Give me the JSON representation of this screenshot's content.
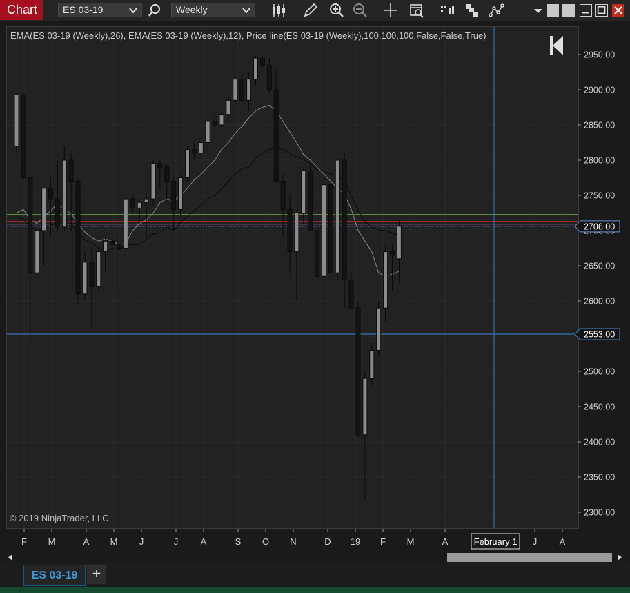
{
  "toolbar": {
    "title": "Chart",
    "instrument": "ES 03-19",
    "interval": "Weekly",
    "icons": [
      "search-icon",
      "candlestick-icon",
      "pencil-icon",
      "zoom-in-icon",
      "zoom-out-icon",
      "crosshair-icon",
      "data-box-icon",
      "bar-spacing-icon",
      "properties-icon",
      "strategy-icon"
    ]
  },
  "indicator_label": "EMA(ES 03-19 (Weekly),26), EMA(ES 03-19 (Weekly),12), Price line(ES 03-19 (Weekly),100,100,100,False,False,True)",
  "copyright": "© 2019 NinjaTrader, LLC",
  "tabs": [
    {
      "label": "ES 03-19",
      "active": true
    }
  ],
  "add_tab_label": "+",
  "chart_data": {
    "type": "candlestick",
    "instrument": "ES 03-19",
    "interval": "Weekly",
    "y_ticks": [
      "2950.00",
      "2900.00",
      "2850.00",
      "2800.00",
      "2750.00",
      "2700.00",
      "2650.00",
      "2600.00",
      "2550.00",
      "2500.00",
      "2450.00",
      "2400.00",
      "2350.00",
      "2300.00"
    ],
    "ylim": [
      2280,
      2975
    ],
    "x_ticks": [
      "F",
      "M",
      "A",
      "M",
      "J",
      "J",
      "A",
      "S",
      "O",
      "N",
      "D",
      "19",
      "F",
      "M",
      "A",
      "February 1",
      "J",
      "A"
    ],
    "price_markers": [
      {
        "label": "2706.00",
        "value": 2706,
        "color": "#6a8fd6"
      },
      {
        "label": "2553.00",
        "value": 2553,
        "color": "#3a8ad6"
      }
    ],
    "reference_lines": [
      {
        "value": 2723,
        "color": "#5a8a3a"
      },
      {
        "value": 2713,
        "color": "#c03030"
      },
      {
        "value": 2709,
        "color": "#8a4a8a"
      },
      {
        "value": 2706,
        "color": "#6a8fd6"
      },
      {
        "value": 2553,
        "color": "#3a8ad6"
      }
    ],
    "crosshair_label": "February 1",
    "candles": [
      {
        "o": 2820,
        "h": 2895,
        "l": 2810,
        "c": 2893
      },
      {
        "o": 2893,
        "h": 2897,
        "l": 2770,
        "c": 2775
      },
      {
        "o": 2775,
        "h": 2775,
        "l": 2545,
        "c": 2640
      },
      {
        "o": 2640,
        "h": 2720,
        "l": 2630,
        "c": 2700
      },
      {
        "o": 2700,
        "h": 2730,
        "l": 2650,
        "c": 2760
      },
      {
        "o": 2760,
        "h": 2775,
        "l": 2690,
        "c": 2745
      },
      {
        "o": 2745,
        "h": 2800,
        "l": 2700,
        "c": 2705
      },
      {
        "o": 2705,
        "h": 2820,
        "l": 2700,
        "c": 2800
      },
      {
        "o": 2800,
        "h": 2810,
        "l": 2700,
        "c": 2770
      },
      {
        "o": 2770,
        "h": 2775,
        "l": 2595,
        "c": 2610
      },
      {
        "o": 2610,
        "h": 2670,
        "l": 2600,
        "c": 2655
      },
      {
        "o": 2655,
        "h": 2675,
        "l": 2560,
        "c": 2620
      },
      {
        "o": 2620,
        "h": 2675,
        "l": 2615,
        "c": 2670
      },
      {
        "o": 2670,
        "h": 2690,
        "l": 2640,
        "c": 2685
      },
      {
        "o": 2685,
        "h": 2700,
        "l": 2620,
        "c": 2680
      },
      {
        "o": 2680,
        "h": 2690,
        "l": 2600,
        "c": 2675
      },
      {
        "o": 2675,
        "h": 2745,
        "l": 2665,
        "c": 2745
      },
      {
        "o": 2745,
        "h": 2750,
        "l": 2725,
        "c": 2732
      },
      {
        "o": 2732,
        "h": 2745,
        "l": 2710,
        "c": 2740
      },
      {
        "o": 2740,
        "h": 2750,
        "l": 2690,
        "c": 2745
      },
      {
        "o": 2745,
        "h": 2800,
        "l": 2735,
        "c": 2795
      },
      {
        "o": 2795,
        "h": 2800,
        "l": 2760,
        "c": 2790
      },
      {
        "o": 2790,
        "h": 2795,
        "l": 2740,
        "c": 2770
      },
      {
        "o": 2770,
        "h": 2775,
        "l": 2700,
        "c": 2730
      },
      {
        "o": 2730,
        "h": 2780,
        "l": 2720,
        "c": 2775
      },
      {
        "o": 2775,
        "h": 2820,
        "l": 2770,
        "c": 2815
      },
      {
        "o": 2815,
        "h": 2825,
        "l": 2800,
        "c": 2810
      },
      {
        "o": 2810,
        "h": 2835,
        "l": 2800,
        "c": 2825
      },
      {
        "o": 2825,
        "h": 2860,
        "l": 2815,
        "c": 2855
      },
      {
        "o": 2855,
        "h": 2865,
        "l": 2840,
        "c": 2850
      },
      {
        "o": 2850,
        "h": 2870,
        "l": 2845,
        "c": 2865
      },
      {
        "o": 2865,
        "h": 2890,
        "l": 2855,
        "c": 2885
      },
      {
        "o": 2885,
        "h": 2920,
        "l": 2880,
        "c": 2915
      },
      {
        "o": 2915,
        "h": 2925,
        "l": 2880,
        "c": 2885
      },
      {
        "o": 2885,
        "h": 2925,
        "l": 2870,
        "c": 2915
      },
      {
        "o": 2915,
        "h": 2950,
        "l": 2905,
        "c": 2945
      },
      {
        "o": 2945,
        "h": 2950,
        "l": 2930,
        "c": 2935
      },
      {
        "o": 2935,
        "h": 2945,
        "l": 2895,
        "c": 2900
      },
      {
        "o": 2900,
        "h": 2930,
        "l": 2770,
        "c": 2770
      },
      {
        "o": 2770,
        "h": 2780,
        "l": 2690,
        "c": 2730
      },
      {
        "o": 2730,
        "h": 2750,
        "l": 2640,
        "c": 2670
      },
      {
        "o": 2670,
        "h": 2730,
        "l": 2600,
        "c": 2725
      },
      {
        "o": 2725,
        "h": 2790,
        "l": 2710,
        "c": 2785
      },
      {
        "o": 2785,
        "h": 2795,
        "l": 2700,
        "c": 2700
      },
      {
        "o": 2700,
        "h": 2745,
        "l": 2630,
        "c": 2635
      },
      {
        "o": 2635,
        "h": 2770,
        "l": 2630,
        "c": 2765
      },
      {
        "o": 2765,
        "h": 2780,
        "l": 2605,
        "c": 2640
      },
      {
        "o": 2640,
        "h": 2800,
        "l": 2630,
        "c": 2800
      },
      {
        "o": 2800,
        "h": 2810,
        "l": 2590,
        "c": 2630
      },
      {
        "o": 2630,
        "h": 2640,
        "l": 2590,
        "c": 2590
      },
      {
        "o": 2590,
        "h": 2600,
        "l": 2405,
        "c": 2410
      },
      {
        "o": 2410,
        "h": 2500,
        "l": 2317,
        "c": 2490
      },
      {
        "o": 2490,
        "h": 2540,
        "l": 2480,
        "c": 2530
      },
      {
        "o": 2530,
        "h": 2600,
        "l": 2520,
        "c": 2590
      },
      {
        "o": 2590,
        "h": 2680,
        "l": 2570,
        "c": 2670
      },
      {
        "o": 2670,
        "h": 2680,
        "l": 2615,
        "c": 2665
      },
      {
        "o": 2660,
        "h": 2715,
        "l": 2625,
        "c": 2706
      }
    ],
    "ema26": [
      2720,
      2716,
      2706,
      2700,
      2702,
      2708,
      2710,
      2715,
      2711,
      2696,
      2687,
      2682,
      2676,
      2670,
      2675,
      2673,
      2679,
      2680,
      2680,
      2688,
      2695,
      2697,
      2705,
      2700,
      2712,
      2720,
      2728,
      2735,
      2745,
      2750,
      2759,
      2770,
      2780,
      2788,
      2790,
      2803,
      2810,
      2815,
      2818,
      2815,
      2810,
      2805,
      2801,
      2796,
      2786,
      2785,
      2780,
      2778,
      2770,
      2750,
      2728,
      2713,
      2705,
      2701,
      2700,
      2697,
      2693
    ],
    "ema12": [
      2725,
      2730,
      2715,
      2710,
      2720,
      2728,
      2738,
      2730,
      2724,
      2710,
      2698,
      2690,
      2685,
      2688,
      2685,
      2680,
      2682,
      2700,
      2710,
      2715,
      2725,
      2740,
      2745,
      2742,
      2750,
      2760,
      2772,
      2780,
      2790,
      2800,
      2815,
      2825,
      2838,
      2848,
      2860,
      2870,
      2875,
      2878,
      2870,
      2855,
      2840,
      2825,
      2808,
      2800,
      2790,
      2780,
      2770,
      2760,
      2752,
      2730,
      2700,
      2685,
      2670,
      2640,
      2635,
      2638,
      2642
    ]
  }
}
